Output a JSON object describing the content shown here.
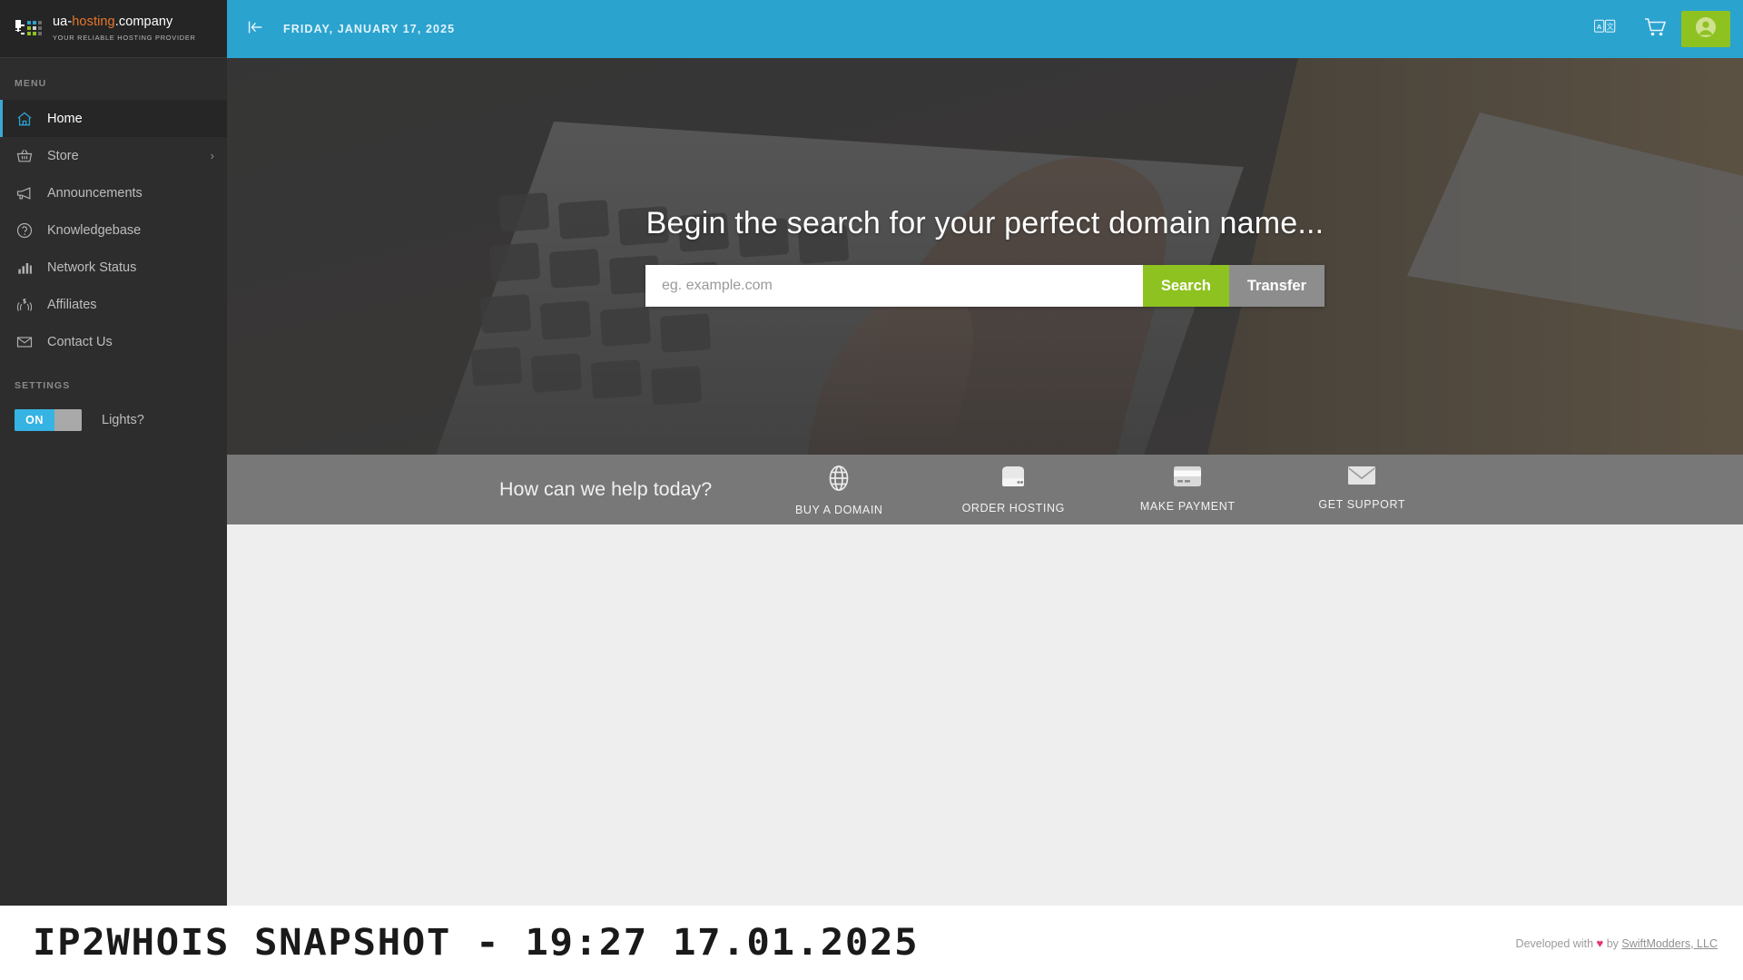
{
  "brand": {
    "name_prefix": "ua-",
    "name_accent": "hosting",
    "name_suffix": ".company",
    "tagline": "YOUR RELIABLE HOSTING PROVIDER",
    "logo_icon": "grid-dots-logo-icon"
  },
  "sidebar": {
    "menu_label": "MENU",
    "settings_label": "SETTINGS",
    "items": [
      {
        "label": "Home",
        "icon": "home-icon",
        "active": true,
        "chevron": ""
      },
      {
        "label": "Store",
        "icon": "basket-icon",
        "active": false,
        "chevron": "›"
      },
      {
        "label": "Announcements",
        "icon": "megaphone-icon",
        "active": false,
        "chevron": ""
      },
      {
        "label": "Knowledgebase",
        "icon": "question-mark-icon",
        "active": false,
        "chevron": ""
      },
      {
        "label": "Network Status",
        "icon": "bar-chart-icon",
        "active": false,
        "chevron": ""
      },
      {
        "label": "Affiliates",
        "icon": "hands-money-icon",
        "active": false,
        "chevron": ""
      },
      {
        "label": "Contact Us",
        "icon": "envelope-icon",
        "active": false,
        "chevron": ""
      }
    ],
    "lights_toggle": {
      "state_label": "ON",
      "label": "Lights?",
      "on_color": "#35b3e2",
      "off_color": "#a9a9a9"
    }
  },
  "topbar": {
    "collapse_icon": "collapse-left-icon",
    "date": "FRIDAY, JANUARY 17, 2025",
    "language_icon": "translate-icon",
    "cart_icon": "shopping-cart-icon",
    "account_icon": "user-avatar-icon",
    "background_color": "#2ba3cf",
    "account_button_color": "#8ec220"
  },
  "hero": {
    "title": "Begin the search for your perfect domain name...",
    "input_placeholder": "eg. example.com",
    "input_value": "",
    "search_label": "Search",
    "transfer_label": "Transfer",
    "search_color": "#8ec220",
    "transfer_color": "#8d8d8d"
  },
  "action_bar": {
    "help_text": "How can we help today?",
    "actions": [
      {
        "label": "BUY A DOMAIN",
        "icon": "globe-icon"
      },
      {
        "label": "ORDER HOSTING",
        "icon": "server-icon"
      },
      {
        "label": "MAKE PAYMENT",
        "icon": "credit-card-icon"
      },
      {
        "label": "GET SUPPORT",
        "icon": "envelope-icon"
      }
    ]
  },
  "footer": {
    "snapshot_title": "IP2WHOIS SNAPSHOT - 19:27 17.01.2025",
    "credit_prefix": "Developed with",
    "credit_heart": "♥",
    "credit_by": "by",
    "credit_company": "SwiftModders, LLC"
  }
}
